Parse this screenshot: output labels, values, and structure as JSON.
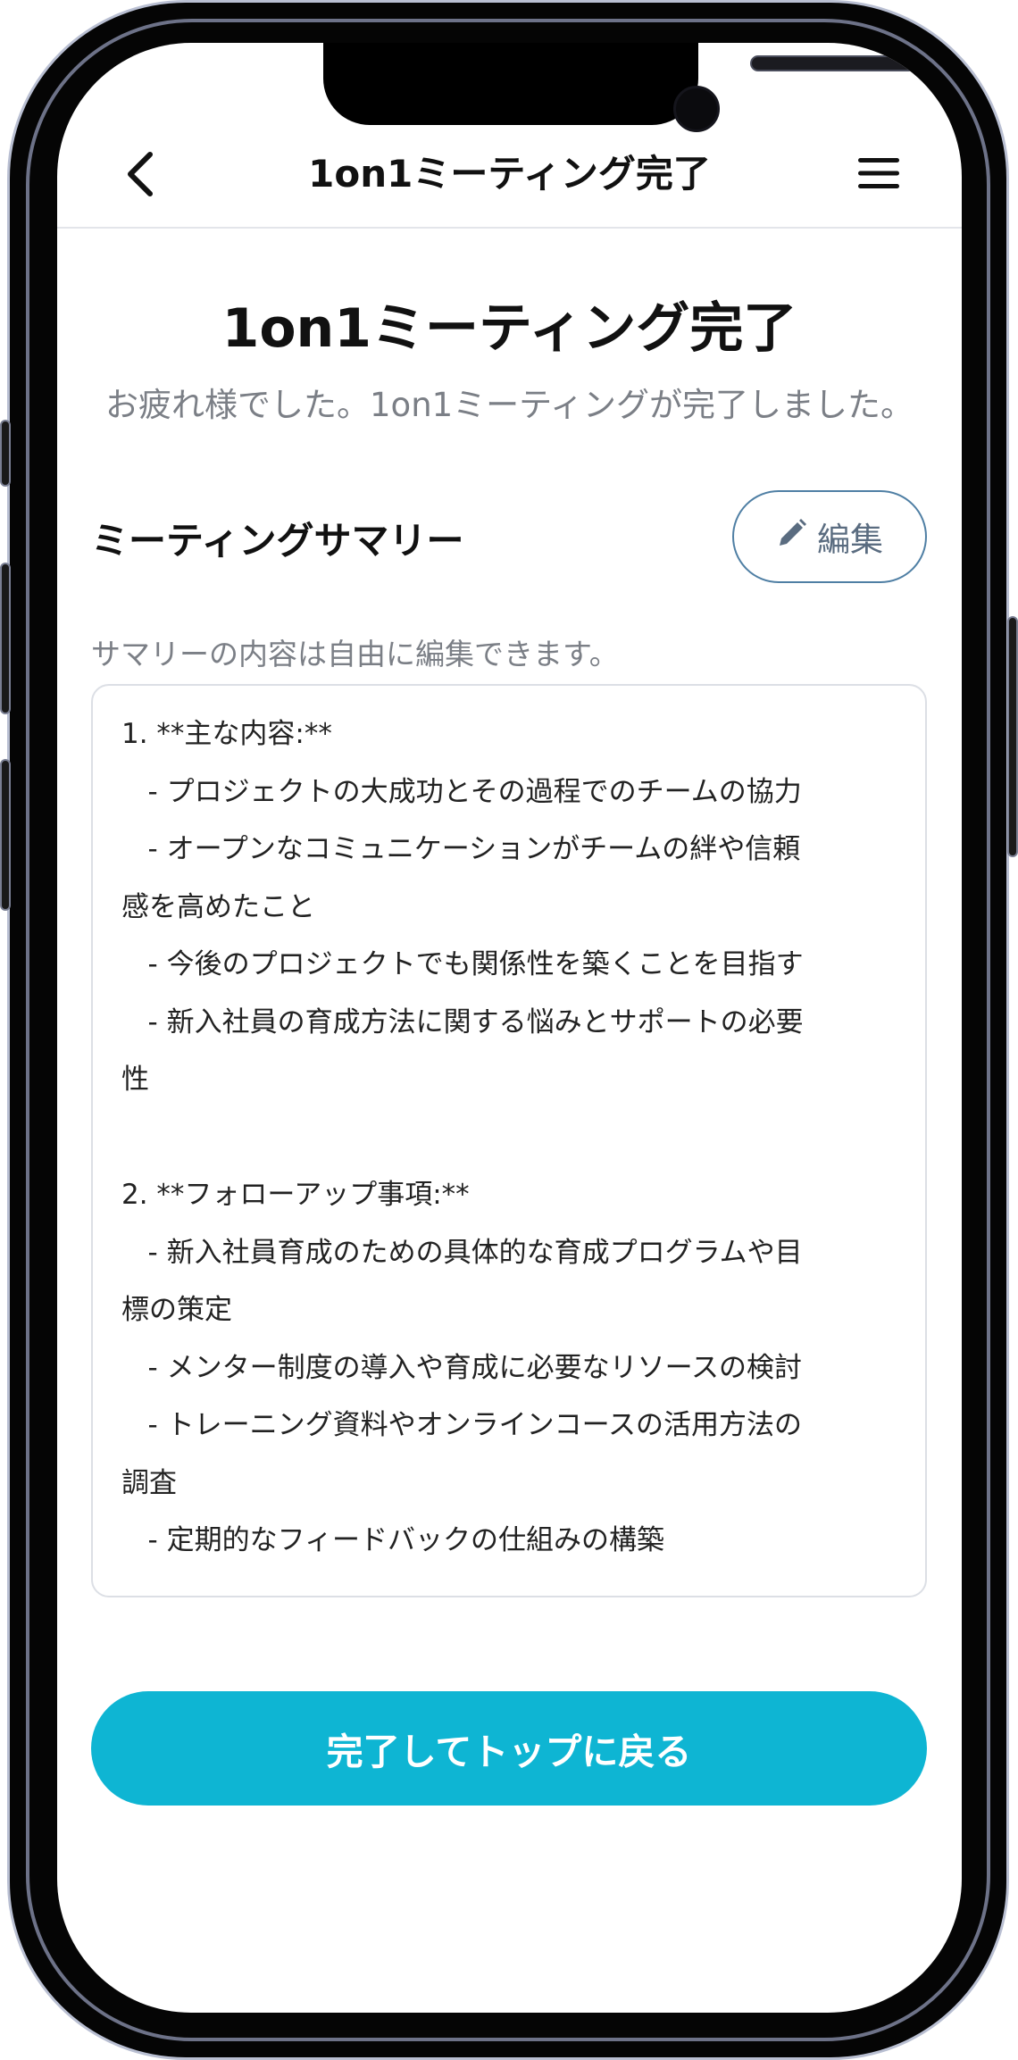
{
  "header": {
    "title": "1on1ミーティング完了"
  },
  "page": {
    "title": "1on1ミーティング完了",
    "subtitle": "お疲れ様でした。1on1ミーティングが完了しました。"
  },
  "summary": {
    "heading": "ミーティングサマリー",
    "edit_label": "編集",
    "helper_text": "サマリーの内容は自由に編集できます。",
    "lines": [
      "1. **主な内容:**",
      "   - プロジェクトの大成功とその過程でのチームの協力",
      "   - オープンなコミュニケーションがチームの絆や信頼",
      "感を高めたこと",
      "   - 今後のプロジェクトでも関係性を築くことを目指す",
      "   - 新入社員の育成方法に関する悩みとサポートの必要",
      "性",
      "",
      "2. **フォローアップ事項:**",
      "   - 新入社員育成のための具体的な育成プログラムや目",
      "標の策定",
      "   - メンター制度の導入や育成に必要なリソースの検討",
      "   - トレーニング資料やオンラインコースの活用方法の",
      "調査",
      "   - 定期的なフィードバックの仕組みの構築"
    ]
  },
  "actions": {
    "done_label": "完了してトップに戻る"
  },
  "icons": {
    "back": "chevron-left-icon",
    "menu": "hamburger-menu-icon",
    "edit": "pencil-icon"
  },
  "colors": {
    "accent": "#0eb5d3",
    "edit_border": "#4f7fa4",
    "muted_text": "#7b7f86"
  }
}
